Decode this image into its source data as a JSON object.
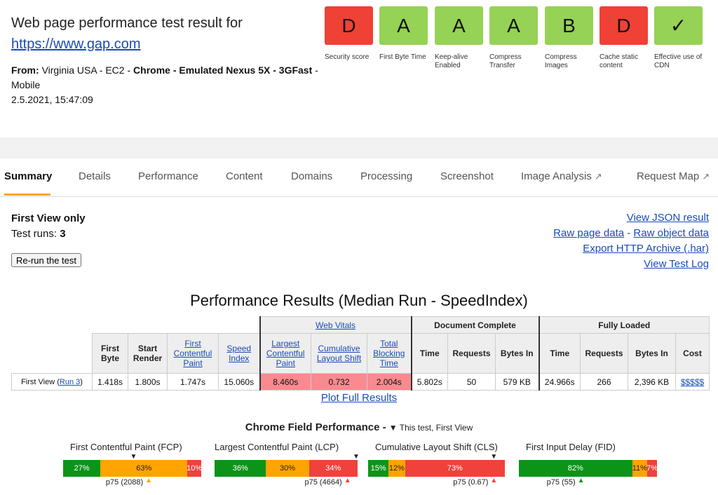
{
  "header": {
    "title": "Web page performance test result for",
    "url": "https://www.gap.com",
    "from_label": "From:",
    "location": "Virginia USA - EC2",
    "browser": "Chrome",
    "device": "Emulated Nexus 5X",
    "connection": "3GFast",
    "platform": "Mobile",
    "timestamp": "2.5.2021, 15:47:09"
  },
  "grades": [
    {
      "grade": "D",
      "label": "Security score",
      "color": "#ef4136"
    },
    {
      "grade": "A",
      "label": "First Byte Time",
      "color": "#95d255"
    },
    {
      "grade": "A",
      "label": "Keep-alive Enabled",
      "color": "#95d255"
    },
    {
      "grade": "A",
      "label": "Compress Transfer",
      "color": "#95d255"
    },
    {
      "grade": "B",
      "label": "Compress Images",
      "color": "#95d255"
    },
    {
      "grade": "D",
      "label": "Cache static content",
      "color": "#ef4136"
    },
    {
      "grade": "✓",
      "label": "Effective use of CDN",
      "color": "#95d255"
    }
  ],
  "tabs": [
    {
      "label": "Summary",
      "active": true
    },
    {
      "label": "Details"
    },
    {
      "label": "Performance"
    },
    {
      "label": "Content"
    },
    {
      "label": "Domains"
    },
    {
      "label": "Processing"
    },
    {
      "label": "Screenshot"
    },
    {
      "label": "Image Analysis",
      "external": true
    },
    {
      "label": "Request Map",
      "external": true
    }
  ],
  "summary": {
    "first_view": "First View only",
    "test_runs_label": "Test runs:",
    "test_runs": "3",
    "rerun": "Re-run the test",
    "links": [
      "View JSON result",
      "Raw page data",
      "-",
      "Raw object data",
      "Export HTTP Archive (.har)",
      "View Test Log"
    ]
  },
  "results": {
    "title": "Performance Results (Median Run - SpeedIndex)",
    "groups": {
      "web_vitals": "Web Vitals",
      "document_complete": "Document Complete",
      "fully_loaded": "Fully Loaded"
    },
    "headers": {
      "first_byte": "First Byte",
      "start_render": "Start Render",
      "fcp": "First Contentful Paint",
      "speed_index": "Speed Index",
      "lcp": "Largest Contentful Paint",
      "cls": "Cumulative Layout Shift",
      "tbt": "Total Blocking Time",
      "dc_time": "Time",
      "dc_requests": "Requests",
      "dc_bytes": "Bytes In",
      "fl_time": "Time",
      "fl_requests": "Requests",
      "fl_bytes": "Bytes In",
      "cost": "Cost"
    },
    "row": {
      "label": "First View (",
      "run": "Run 3",
      "label_end": ")",
      "first_byte": "1.418s",
      "start_render": "1.800s",
      "fcp": "1.747s",
      "speed_index": "15.060s",
      "lcp": "8.460s",
      "cls": "0.732",
      "tbt": "2.004s",
      "dc_time": "5.802s",
      "dc_requests": "50",
      "dc_bytes": "579 KB",
      "fl_time": "24.966s",
      "fl_requests": "266",
      "fl_bytes": "2,396 KB",
      "cost": "$$$$$"
    },
    "plot_link": "Plot Full Results"
  },
  "field": {
    "title": "Chrome Field Performance -",
    "legend": "▼ This test, First View",
    "colors": {
      "good": "#0c9419",
      "ni": "#ffa400",
      "poor": "#f0413d"
    },
    "metrics": [
      {
        "title": "First Contentful Paint (FCP)",
        "good": 27,
        "ni": 63,
        "poor": 10,
        "labels": [
          "27%",
          "63%",
          "10%"
        ],
        "p75": "p75 (2088)",
        "p75_status": "ni",
        "p75_pos": 0.62,
        "test_pos": 0.51
      },
      {
        "title": "Largest Contentful Paint (LCP)",
        "good": 36,
        "ni": 30,
        "poor": 34,
        "labels": [
          "36%",
          "30%",
          "34%"
        ],
        "p75": "p75 (4664)",
        "p75_status": "poor",
        "p75_pos": 0.93,
        "test_pos": 0.99
      },
      {
        "title": "Cumulative Layout Shift (CLS)",
        "good": 15,
        "ni": 12,
        "poor": 73,
        "labels": [
          "15%",
          "12%",
          "73%"
        ],
        "p75": "p75 (0.67)",
        "p75_status": "poor",
        "p75_pos": 0.92,
        "test_pos": 0.92
      },
      {
        "title": "First Input Delay (FID)",
        "good": 82,
        "ni": 11,
        "poor": 7,
        "labels": [
          "82%",
          "11%",
          "7%"
        ],
        "p75": "p75 (55)",
        "p75_status": "good",
        "p75_pos": 0.45,
        "test_pos": null
      }
    ]
  }
}
